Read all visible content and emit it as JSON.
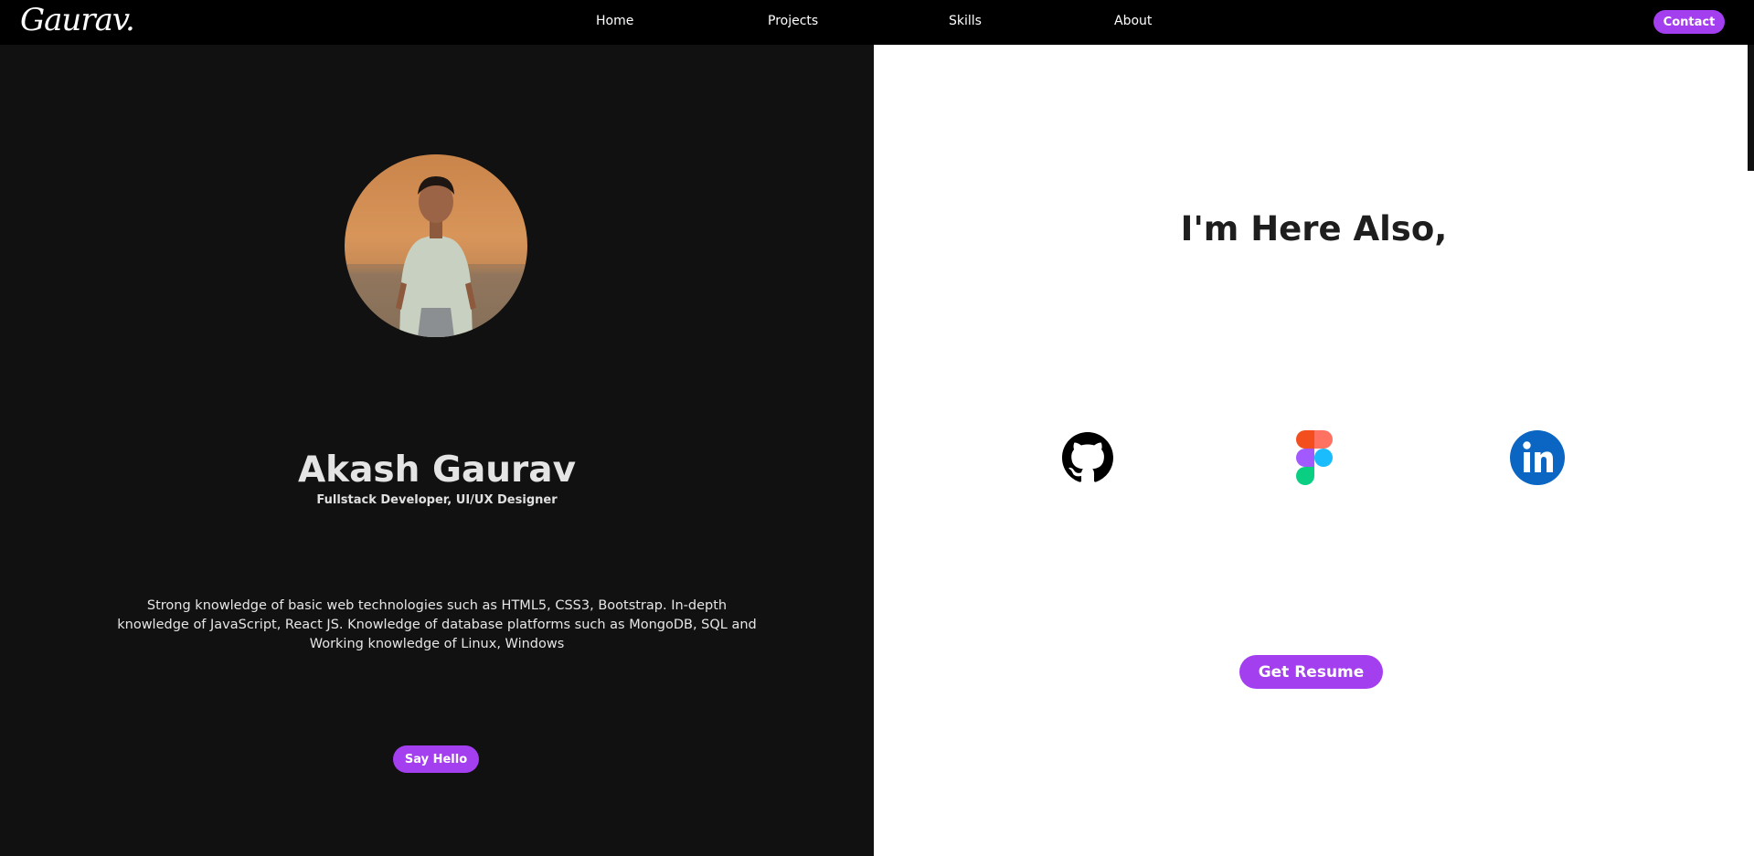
{
  "nav": {
    "logo": "Gaurav.",
    "links": [
      "Home",
      "Projects",
      "Skills",
      "About"
    ],
    "contact_label": "Contact"
  },
  "profile": {
    "name": "Akash Gaurav",
    "role": "Fullstack Developer, UI/UX Designer",
    "bio": "Strong knowledge of basic web technologies such as HTML5, CSS3, Bootstrap. In-depth knowledge of JavaScript, React JS. Knowledge of database platforms such as MongoDB, SQL and Working knowledge of Linux, Windows",
    "cta_label": "Say Hello"
  },
  "links_section": {
    "heading": "I'm Here Also,",
    "socials": [
      "github-icon",
      "figma-icon",
      "linkedin-icon"
    ],
    "resume_label": "Get Resume"
  },
  "colors": {
    "accent": "#a43ff0",
    "dark_bg": "#111111",
    "navbar_bg": "#000000",
    "light_bg": "#ffffff",
    "linkedin": "#0a66c2"
  }
}
